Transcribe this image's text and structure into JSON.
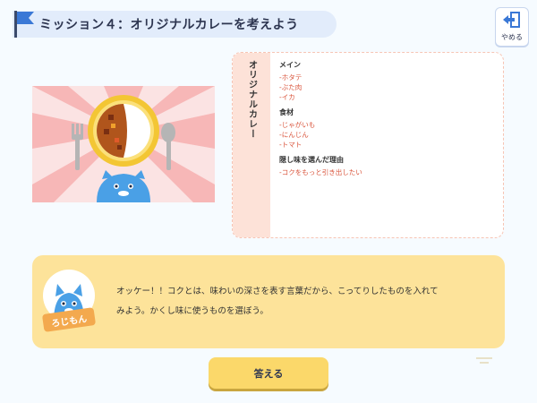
{
  "header": {
    "mission_title": "ミッション４：オリジナルカレーを考えよう",
    "flag_icon": "flag-icon",
    "quit_label": "やめる",
    "quit_icon": "exit-door-icon"
  },
  "illustration": {
    "description_icons": [
      "curry-plate-icon",
      "fork-icon",
      "spoon-icon",
      "character-icon"
    ]
  },
  "recipe": {
    "name": "オリジナルカレー",
    "sections": [
      {
        "heading": "メイン",
        "items": [
          "ホタテ",
          "ぶた肉",
          "イカ"
        ]
      },
      {
        "heading": "食材",
        "items": [
          "じゃがいも",
          "にんじん",
          "トマト"
        ]
      },
      {
        "heading": "隠し味を選んだ理由",
        "items": [
          "コクをもっと引き出したい"
        ]
      }
    ],
    "item_prefix": "-"
  },
  "speech": {
    "character_name": "ろじもん",
    "text_line1": "オッケー！！コクとは、味わいの深さを表す言葉だから、こってりしたものを入れて",
    "text_line2": "みよう。かくし味に使うものを選ぼう。"
  },
  "answer": {
    "label": "答える"
  },
  "colors": {
    "background": "#f6fbff",
    "accent_orange": "#d9533a",
    "speech_bg": "#fde39a",
    "button_bg": "#fbd86a",
    "recipe_side": "#fde2d8"
  }
}
